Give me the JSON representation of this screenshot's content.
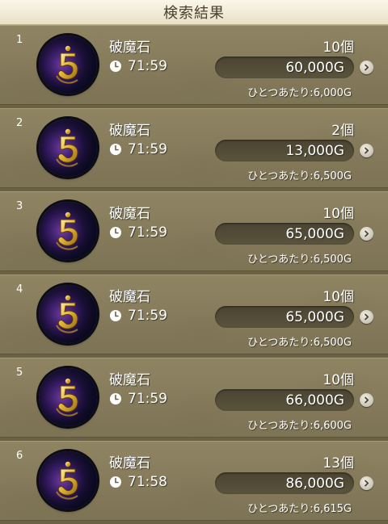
{
  "header": {
    "title": "検索結果"
  },
  "colors": {
    "header_bg": "#f3ecd8",
    "row_bg": "#877c5b",
    "pill_bg": "#514a37",
    "text": "#ffffff",
    "icon_gold": "#e6b93a",
    "icon_dark": "#1b1036"
  },
  "rows": [
    {
      "index": "1",
      "icon": "hakai-stone-icon",
      "name": "破魔石",
      "time": "71:59",
      "quantity": "10個",
      "price": "60,000G",
      "unit_label": "ひとつあたり:",
      "unit_price": "6,000G"
    },
    {
      "index": "2",
      "icon": "hakai-stone-icon",
      "name": "破魔石",
      "time": "71:59",
      "quantity": "2個",
      "price": "13,000G",
      "unit_label": "ひとつあたり:",
      "unit_price": "6,500G"
    },
    {
      "index": "3",
      "icon": "hakai-stone-icon",
      "name": "破魔石",
      "time": "71:59",
      "quantity": "10個",
      "price": "65,000G",
      "unit_label": "ひとつあたり:",
      "unit_price": "6,500G"
    },
    {
      "index": "4",
      "icon": "hakai-stone-icon",
      "name": "破魔石",
      "time": "71:59",
      "quantity": "10個",
      "price": "65,000G",
      "unit_label": "ひとつあたり:",
      "unit_price": "6,500G"
    },
    {
      "index": "5",
      "icon": "hakai-stone-icon",
      "name": "破魔石",
      "time": "71:59",
      "quantity": "10個",
      "price": "66,000G",
      "unit_label": "ひとつあたり:",
      "unit_price": "6,600G"
    },
    {
      "index": "6",
      "icon": "hakai-stone-icon",
      "name": "破魔石",
      "time": "71:58",
      "quantity": "13個",
      "price": "86,000G",
      "unit_label": "ひとつあたり:",
      "unit_price": "6,615G"
    }
  ]
}
